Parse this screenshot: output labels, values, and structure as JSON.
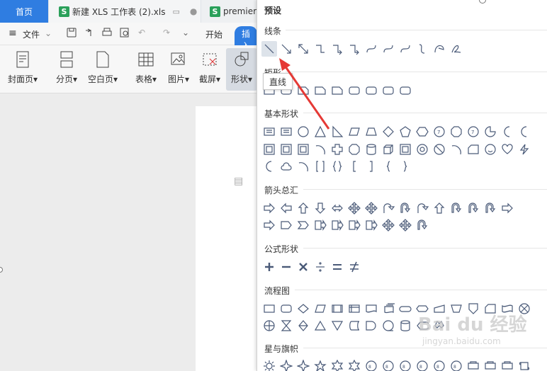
{
  "tabs": {
    "home": "首页",
    "xls": "新建 XLS 工作表 (2).xls",
    "prem": "premier"
  },
  "menu": {
    "file": "文件",
    "start": "开始",
    "insert": "插入"
  },
  "ribbon": {
    "cover": "封面页",
    "section": "分页",
    "blank": "空白页",
    "table": "表格",
    "picture": "图片",
    "screenshot": "截屏",
    "shape": "形状"
  },
  "panel": {
    "preset": "预设",
    "sections": [
      "线条",
      "矩形",
      "基本形状",
      "箭头总汇",
      "公式形状",
      "流程图",
      "星与旗帜"
    ],
    "tooltip": "直线"
  },
  "watermark": {
    "brand": "Bai du 经验",
    "url": "jingyan.baidu.com"
  },
  "colors": {
    "accent": "#2f7de1",
    "arrow": "#e53935"
  }
}
